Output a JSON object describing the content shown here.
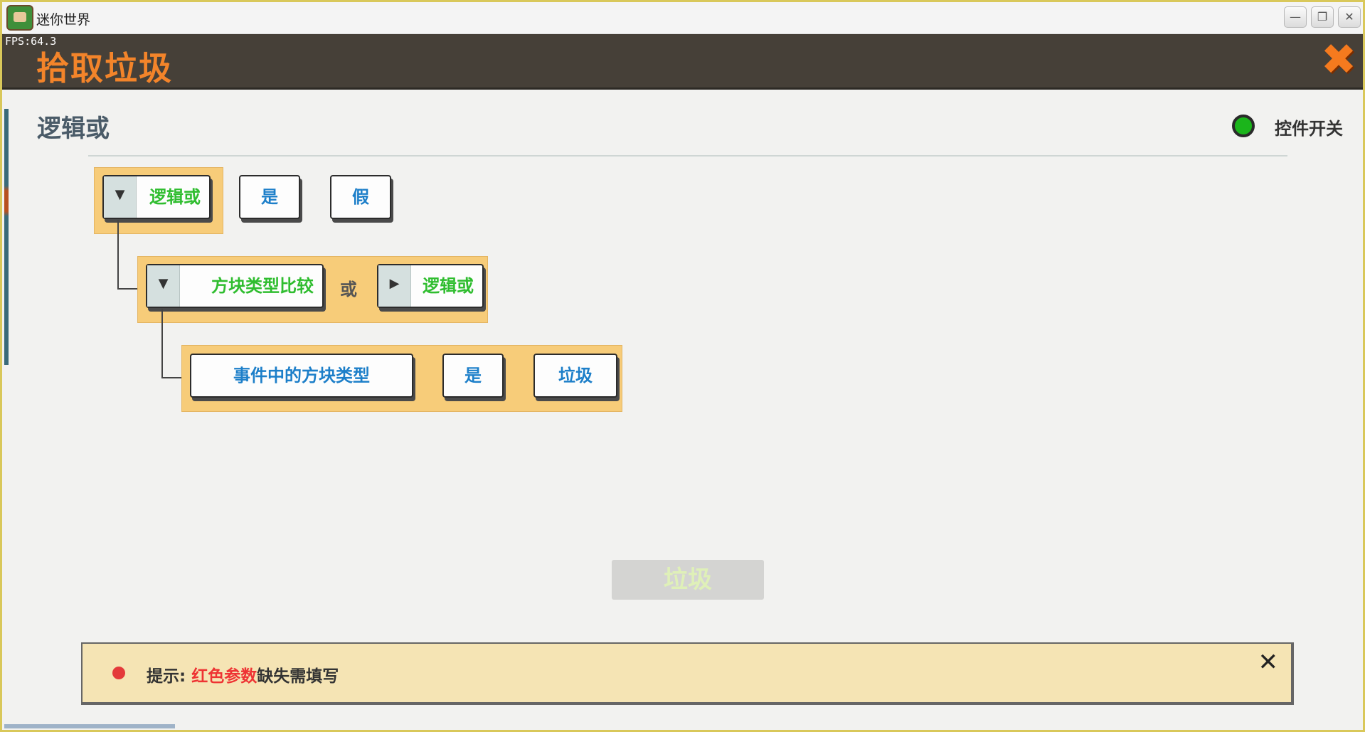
{
  "os": {
    "title": "迷你世界",
    "fps": "FPS:64.3",
    "minimize_icon": "minimize-icon",
    "restore_icon": "restore-icon",
    "close_icon": "close-icon"
  },
  "header": {
    "title": "拾取垃圾",
    "close_icon": "close-x-icon",
    "title_color": "#f3842a"
  },
  "panel": {
    "section_title": "逻辑或",
    "toggle_label": "控件开关",
    "toggle_color": "#1bb51b"
  },
  "rows": {
    "row1": {
      "func": "逻辑或",
      "arg1": "是",
      "arg2": "假"
    },
    "row2": {
      "func": "方块类型比较",
      "op": "或",
      "arg": "逻辑或"
    },
    "row3": {
      "arg1": "事件中的方块类型",
      "arg2": "是",
      "arg3": "垃圾"
    }
  },
  "preview_button": "垃圾",
  "tip": {
    "prefix": "提示: ",
    "highlight": "红色参数",
    "suffix": "缺失需填写",
    "highlight_color": "#e33333"
  }
}
